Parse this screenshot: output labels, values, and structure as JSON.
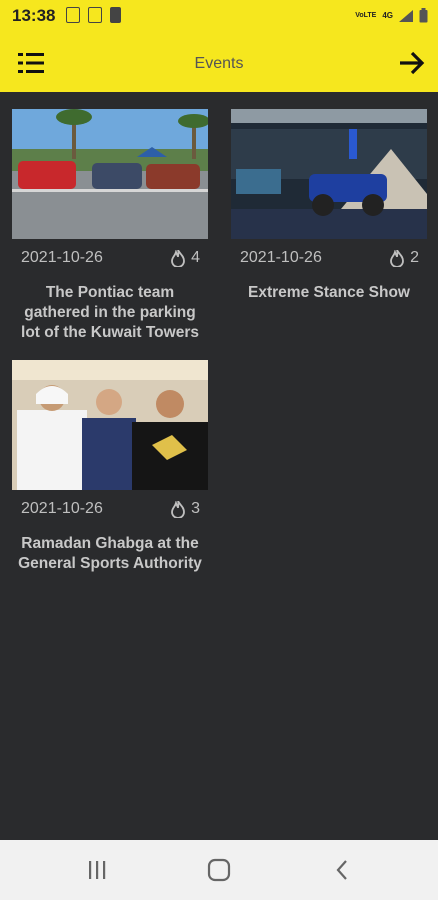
{
  "status_bar": {
    "time": "13:38",
    "network": "4G"
  },
  "app_bar": {
    "title": "Events",
    "menu_icon": "hamburger-menu-icon",
    "forward_icon": "arrow-right-icon"
  },
  "events": [
    {
      "date": "2021-10-26",
      "likes": "4",
      "title": "The Pontiac team gathered in the parking lot of the Kuwait Towers",
      "image": "cars-parking-lot-photo"
    },
    {
      "date": "2021-10-26",
      "likes": "2",
      "title": "Extreme Stance Show",
      "image": "monster-truck-show-photo"
    },
    {
      "date": "2021-10-26",
      "likes": "3",
      "title": "Ramadan Ghabga at the General Sports Authority",
      "image": "group-portrait-photo"
    }
  ],
  "nav_bar": {
    "recents_icon": "recent-apps-icon",
    "home_icon": "home-icon",
    "back_icon": "back-icon"
  },
  "colors": {
    "accent": "#f6e71e",
    "background": "#2a2b2d",
    "text": "#c8c8c8"
  }
}
